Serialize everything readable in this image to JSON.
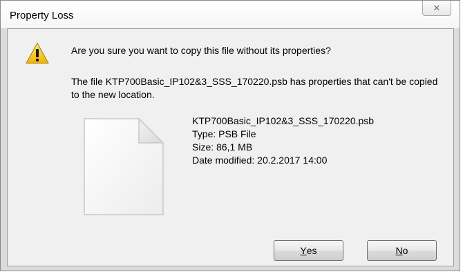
{
  "window": {
    "title": "Property Loss",
    "close_glyph": "✕"
  },
  "dialog": {
    "question": "Are you sure you want to copy this file without its properties?",
    "detail": "The file KTP700Basic_IP102&3_SSS_170220.psb has properties that can't be copied to the new location.",
    "warning_icon": "warning-icon",
    "file_icon": "file-icon"
  },
  "file": {
    "name": "KTP700Basic_IP102&3_SSS_170220.psb",
    "type": "Type: PSB File",
    "size": "Size: 86,1 MB",
    "date_modified": "Date modified: 20.2.2017 14:00"
  },
  "buttons": {
    "yes": {
      "accel": "Y",
      "rest": "es"
    },
    "no": {
      "accel": "N",
      "rest": "o"
    }
  },
  "colors": {
    "warning_yellow": "#f5c20b",
    "dialog_bg": "#f0f0f0"
  }
}
